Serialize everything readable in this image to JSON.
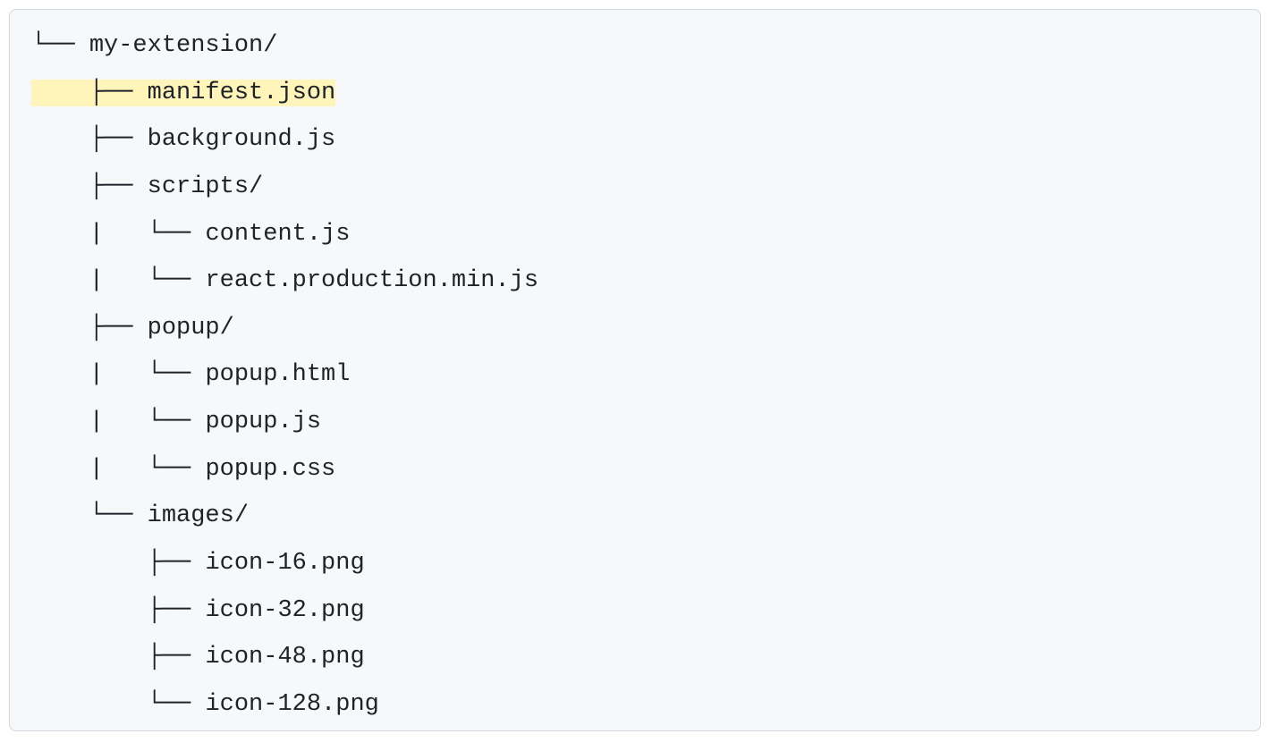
{
  "tree": {
    "lines": [
      {
        "prefix": "└── ",
        "name": "my-extension/",
        "highlight": false
      },
      {
        "prefix": "    ├── ",
        "name": "manifest.json",
        "highlight": true
      },
      {
        "prefix": "    ├── ",
        "name": "background.js",
        "highlight": false
      },
      {
        "prefix": "    ├── ",
        "name": "scripts/",
        "highlight": false
      },
      {
        "prefix": "    |   └── ",
        "name": "content.js",
        "highlight": false
      },
      {
        "prefix": "    |   └── ",
        "name": "react.production.min.js",
        "highlight": false
      },
      {
        "prefix": "    ├── ",
        "name": "popup/",
        "highlight": false
      },
      {
        "prefix": "    |   └── ",
        "name": "popup.html",
        "highlight": false
      },
      {
        "prefix": "    |   └── ",
        "name": "popup.js",
        "highlight": false
      },
      {
        "prefix": "    |   └── ",
        "name": "popup.css",
        "highlight": false
      },
      {
        "prefix": "    └── ",
        "name": "images/",
        "highlight": false
      },
      {
        "prefix": "        ├── ",
        "name": "icon-16.png",
        "highlight": false
      },
      {
        "prefix": "        ├── ",
        "name": "icon-32.png",
        "highlight": false
      },
      {
        "prefix": "        ├── ",
        "name": "icon-48.png",
        "highlight": false
      },
      {
        "prefix": "        └── ",
        "name": "icon-128.png",
        "highlight": false
      }
    ]
  }
}
